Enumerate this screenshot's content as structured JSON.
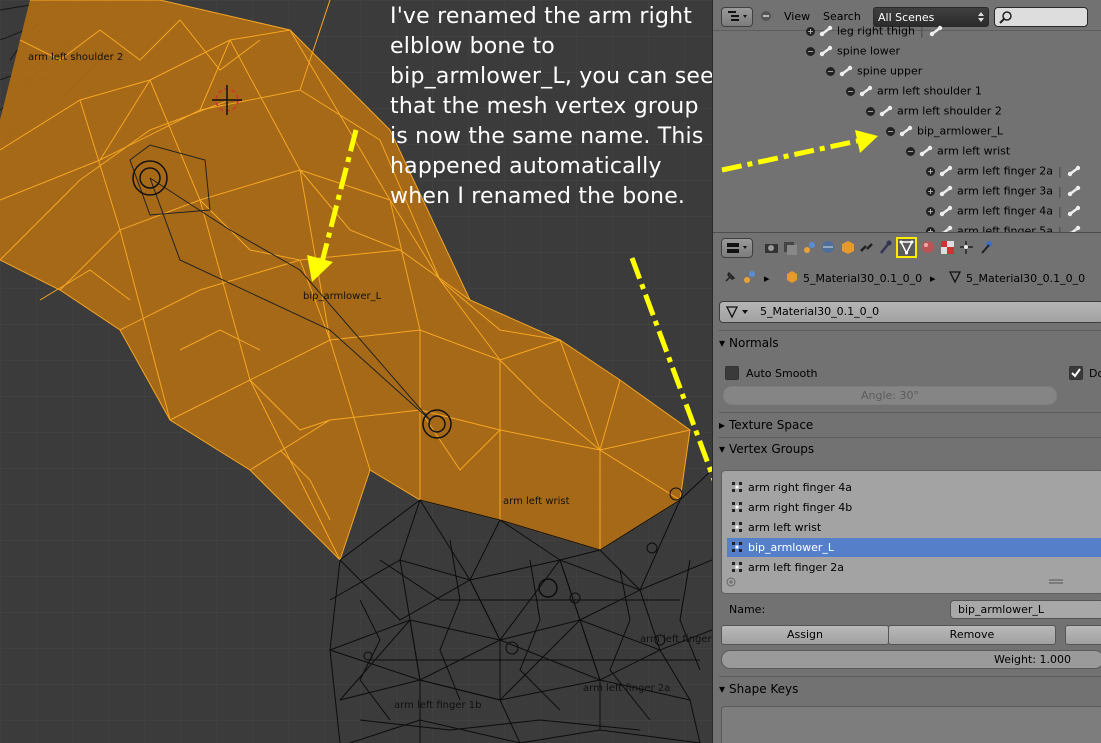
{
  "annotation": {
    "text": "I've renamed the arm right elblow bone to bip_armlower_L, you can see that the mesh vertex group is now the same name. This happened automatically when I renamed the bone."
  },
  "viewport": {
    "labels": {
      "shoulder": "arm left shoulder 2",
      "armlower": "bip_armlower_L",
      "wrist": "arm left wrist",
      "finger_3": "arm left finger 3",
      "finger_2a": "arm left finger 2a",
      "finger_1b": "arm left finger 1b"
    },
    "colors": {
      "selected_mesh": "#f2a423",
      "wire": "#111111",
      "arrow": "#ffff00"
    }
  },
  "outliner": {
    "header": {
      "view": "View",
      "search": "Search",
      "scene_filter": "All Scenes"
    },
    "rows": [
      {
        "label": "leg right thigh",
        "indent": 0
      },
      {
        "label": "spine lower",
        "indent": 0
      },
      {
        "label": "spine upper",
        "indent": 1
      },
      {
        "label": "arm left shoulder 1",
        "indent": 2
      },
      {
        "label": "arm left shoulder 2",
        "indent": 3
      },
      {
        "label": "bip_armlower_L",
        "indent": 4
      },
      {
        "label": "arm left wrist",
        "indent": 5
      },
      {
        "label": "arm left finger 2a",
        "indent": 6
      },
      {
        "label": "arm left finger 3a",
        "indent": 6
      },
      {
        "label": "arm left finger 4a",
        "indent": 6
      },
      {
        "label": "arm left finger 5a",
        "indent": 6
      }
    ]
  },
  "properties": {
    "breadcrumb": {
      "object": "5_Material30_0.1_0_0",
      "mesh": "5_Material30_0.1_0_0"
    },
    "datablock_name": "5_Material30_0.1_0_0",
    "normals": {
      "title": "Normals",
      "auto_smooth": "Auto Smooth",
      "double_sided": "Do",
      "angle": "Angle: 30°"
    },
    "texture_space": {
      "title": "Texture Space"
    },
    "vertex_groups": {
      "title": "Vertex Groups",
      "items": [
        "arm right finger 4a",
        "arm right finger 4b",
        "arm left wrist",
        "bip_armlower_L",
        "arm left finger 2a"
      ],
      "selected": "bip_armlower_L",
      "name_label": "Name:",
      "name_value": "bip_armlower_L",
      "assign": "Assign",
      "remove": "Remove",
      "weight": "Weight: 1.000"
    },
    "shape_keys": {
      "title": "Shape Keys"
    }
  }
}
